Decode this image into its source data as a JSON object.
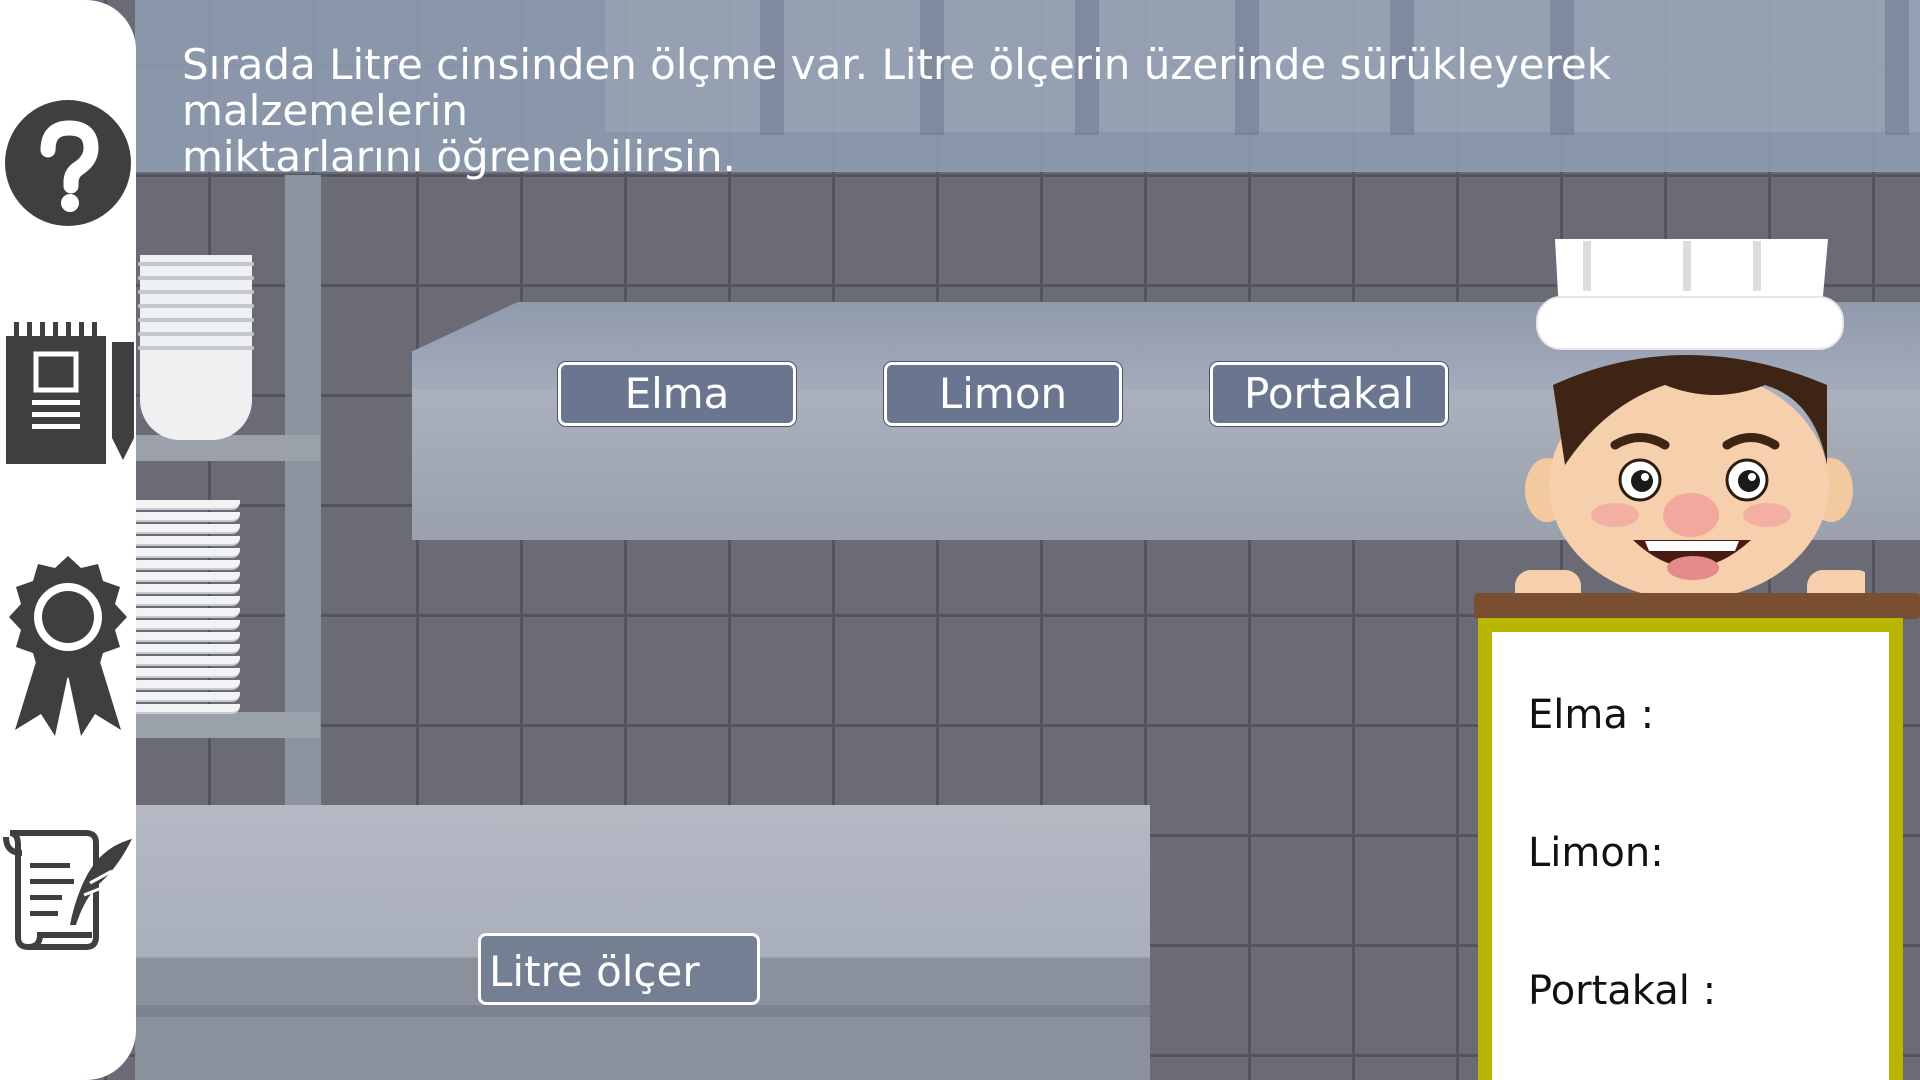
{
  "instruction": {
    "line1": "Sırada Litre cinsinden ölçme var. Litre ölçerin üzerinde sürükleyerek malzemelerin",
    "line2": "miktarlarını öğrenebilirsin."
  },
  "sidebar": {
    "items": [
      {
        "name": "help-button",
        "icon": "question-mark-icon"
      },
      {
        "name": "notebook-button",
        "icon": "notepad-pencil-icon"
      },
      {
        "name": "achievements-button",
        "icon": "award-ribbon-icon"
      },
      {
        "name": "notes-button",
        "icon": "scroll-quill-icon"
      }
    ]
  },
  "ingredients": [
    {
      "label": "Elma"
    },
    {
      "label": "Limon"
    },
    {
      "label": "Portakal"
    }
  ],
  "measure_tool": {
    "label": "Litre ölçer"
  },
  "results_board": {
    "rows": [
      {
        "label": "Elma :"
      },
      {
        "label": "Limon:"
      },
      {
        "label": "Portakal :"
      }
    ]
  },
  "colors": {
    "board_frame": "#b8b600",
    "button_fill": "#6a7690",
    "board_ledge": "#7a4f31"
  }
}
